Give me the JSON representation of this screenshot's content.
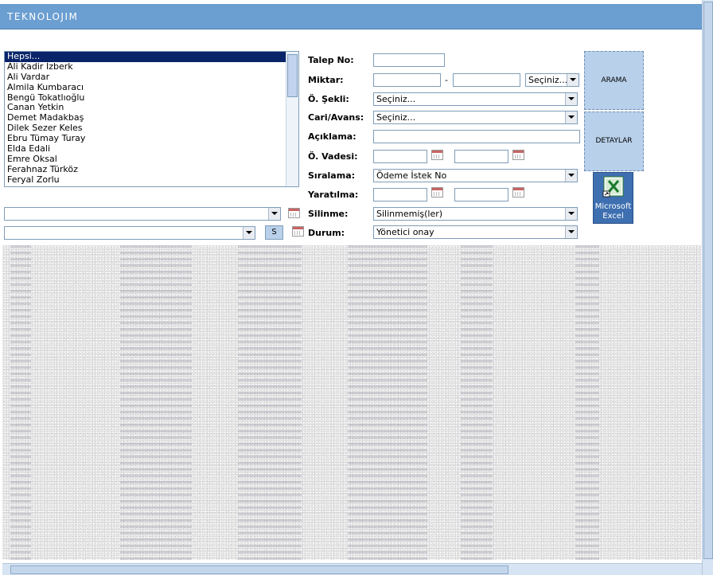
{
  "app": {
    "title": "TEKNOLOJIM"
  },
  "userList": {
    "items": [
      "Hepsi...",
      "Ali Kadir İzberk",
      "Ali Vardar",
      "Almila Kumbaracı",
      "Bengü Tokatlıoğlu",
      "Canan Yetkin",
      "Demet Madakbaş",
      "Dilek Sezer Keles",
      "Ebru Tümay Turay",
      "Elda Edali",
      "Emre Oksal",
      "Ferahnaz Türköz",
      "Feryal Zorlu"
    ],
    "selected_index": 0
  },
  "leftControls": {
    "combo1_value": "",
    "combo2_value": "",
    "s_button_label": "S"
  },
  "form": {
    "talep_no": {
      "label": "Talep No:",
      "value": ""
    },
    "miktar": {
      "label": "Miktar:",
      "from": "",
      "to": "",
      "separator": "-",
      "currency": "Seçiniz..."
    },
    "odeme_sekli": {
      "label": "Ö. Şekli:",
      "value": "Seçiniz..."
    },
    "cari_avans": {
      "label": "Cari/Avans:",
      "value": "Seçiniz..."
    },
    "aciklama": {
      "label": "Açıklama:",
      "value": ""
    },
    "odeme_vadesi": {
      "label": "Ö. Vadesi:",
      "from": "",
      "to": ""
    },
    "siralama": {
      "label": "Sıralama:",
      "value": "Ödeme İstek No"
    },
    "yaratilma": {
      "label": "Yaratılma:",
      "from": "",
      "to": ""
    },
    "silinme": {
      "label": "Silinme:",
      "value": "Silinmemiş(ler)"
    },
    "durum": {
      "label": "Durum:",
      "value": "Yönetici onay"
    }
  },
  "buttons": {
    "arama": "ARAMA",
    "detaylar": "DETAYLAR",
    "excel": "Microsoft Excel"
  },
  "colors": {
    "title_bar": "#6b9ed1",
    "button_fill": "#b8d0ea",
    "excel_fill": "#3e6fb0"
  }
}
